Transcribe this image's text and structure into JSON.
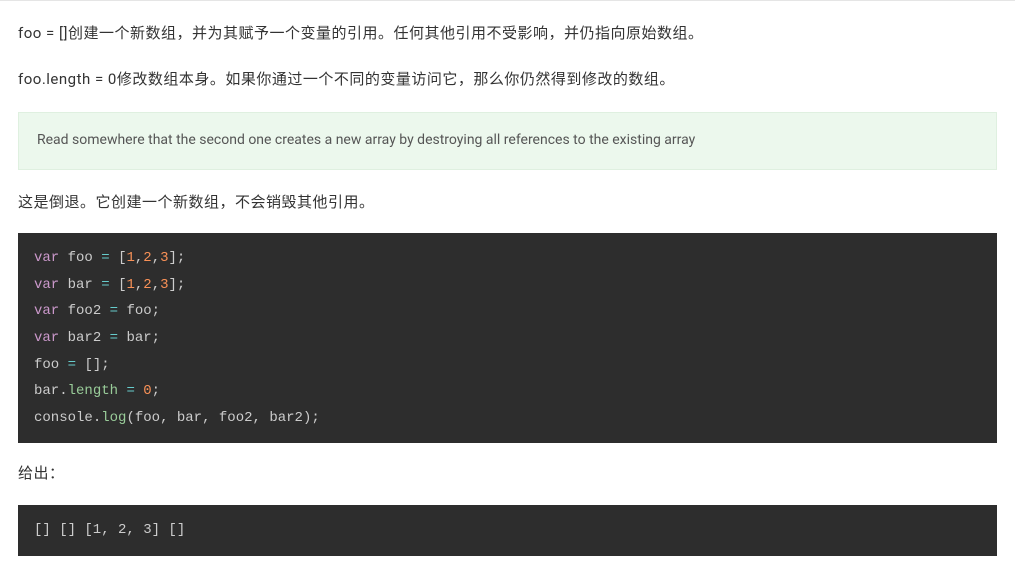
{
  "para1": "foo = []创建一个新数组，并为其赋予一个变量的引用。任何其他引用不受影响，并仍指向原始数组。",
  "para2": "foo.length = 0修改数组本身。如果你通过一个不同的变量访问它，那么你仍然得到修改的数组。",
  "quote": "Read somewhere that the second one creates a new array by destroying all references to the existing array",
  "para3": "这是倒退。它创建一个新数组，不会销毁其他引用。",
  "para4": "给出：",
  "code1": {
    "l1": {
      "kw": "var",
      "v1": "foo",
      "eq": "=",
      "open": "[",
      "n1": "1",
      "c1": ",",
      "n2": "2",
      "c2": ",",
      "n3": "3",
      "close": "]",
      "semi": ";"
    },
    "l2": {
      "kw": "var",
      "v1": "bar",
      "eq": "=",
      "open": "[",
      "n1": "1",
      "c1": ",",
      "n2": "2",
      "c2": ",",
      "n3": "3",
      "close": "]",
      "semi": ";"
    },
    "l3": {
      "kw": "var",
      "v1": "foo2",
      "eq": "=",
      "v2": "foo",
      "semi": ";"
    },
    "l4": {
      "kw": "var",
      "v1": "bar2",
      "eq": "=",
      "v2": "bar",
      "semi": ";"
    },
    "l5": {
      "v1": "foo",
      "eq": "=",
      "open": "[",
      "close": "]",
      "semi": ";"
    },
    "l6": {
      "v1": "bar",
      "dot": ".",
      "prop": "length",
      "eq": "=",
      "n": "0",
      "semi": ";"
    },
    "l7": {
      "obj": "console",
      "dot": ".",
      "fn": "log",
      "open": "(",
      "a1": "foo",
      "c1": ",",
      "a2": "bar",
      "c2": ",",
      "a3": "foo2",
      "c3": ",",
      "a4": "bar2",
      "close": ")",
      "semi": ";"
    }
  },
  "output1": "[] [] [1, 2, 3] []"
}
